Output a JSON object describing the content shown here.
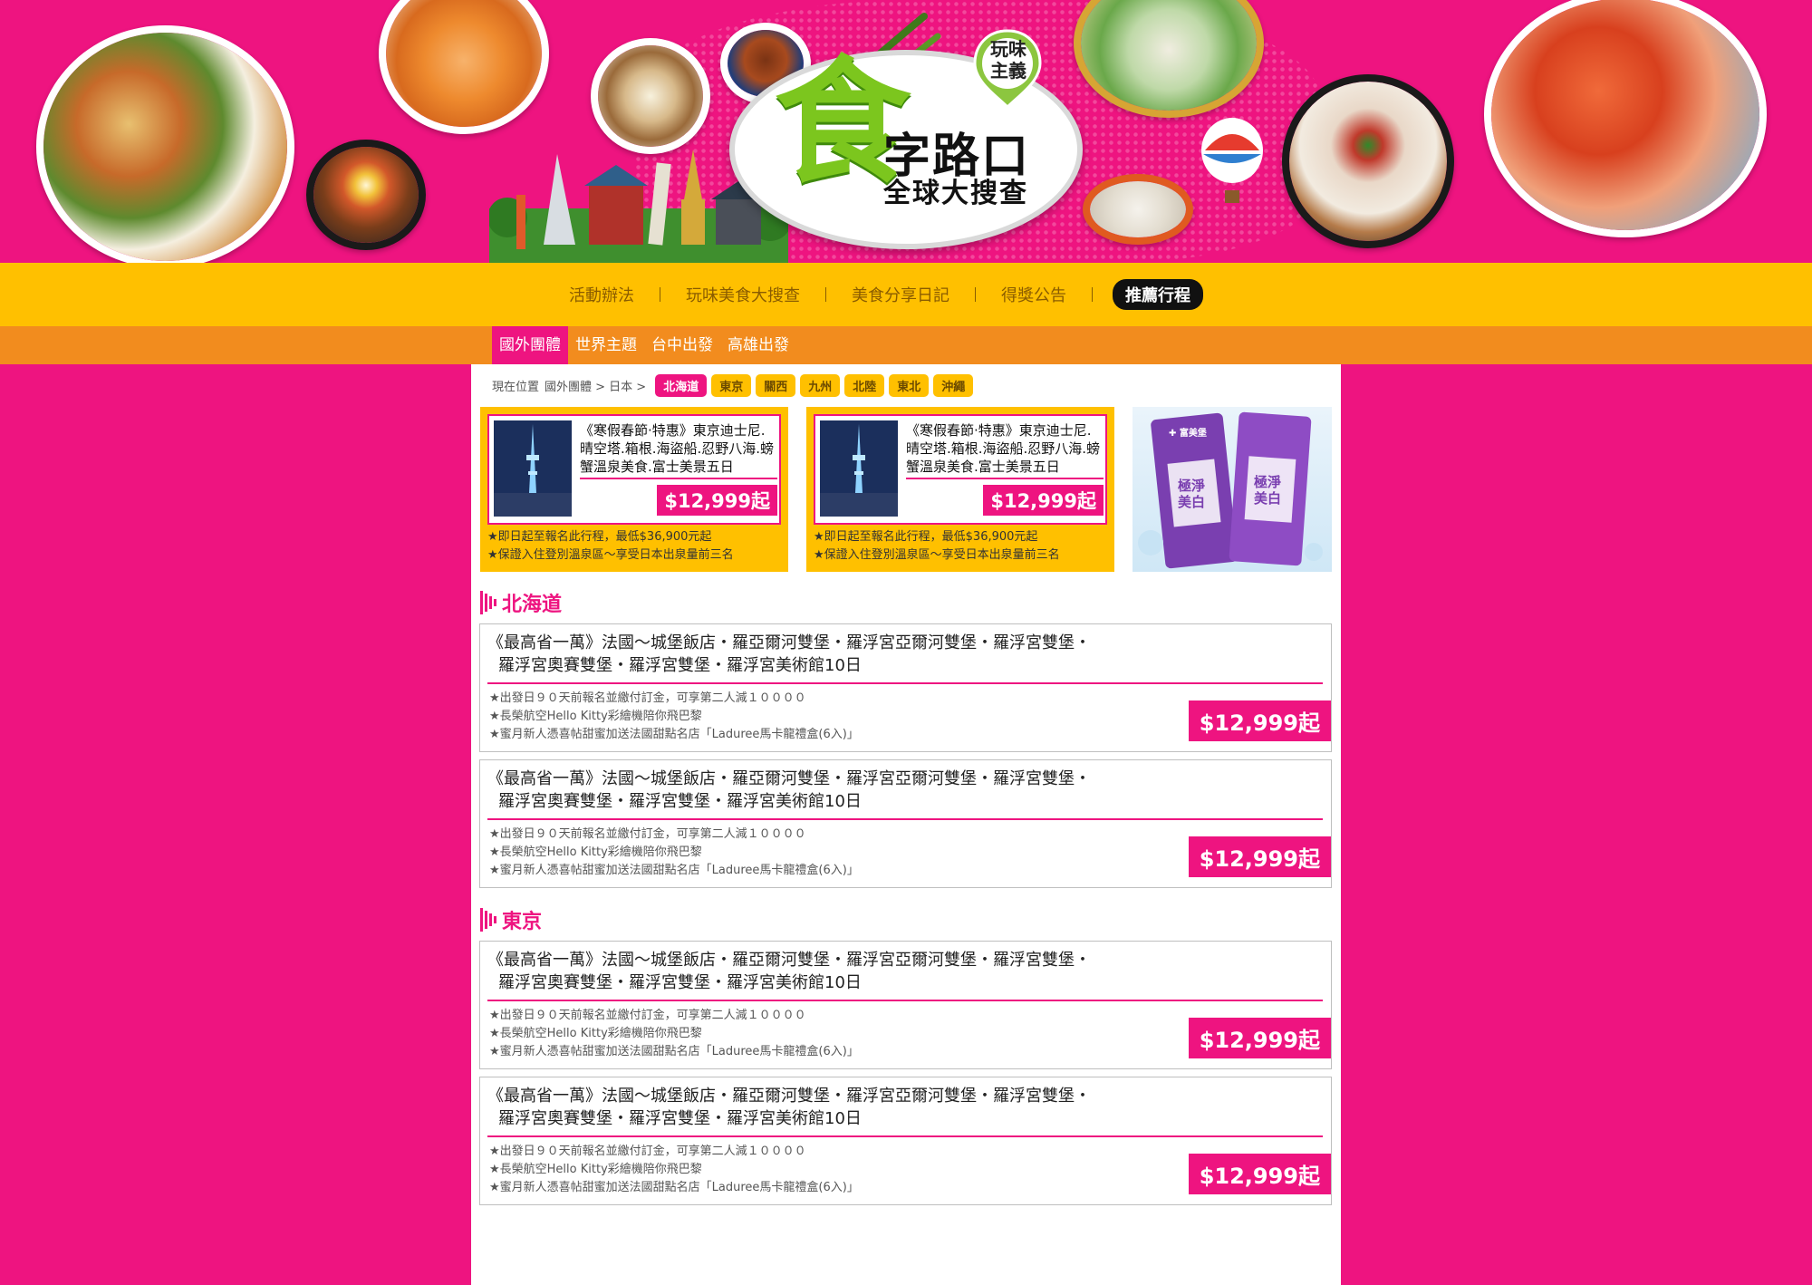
{
  "banner": {
    "logo_char": "食",
    "logo_line1": "字路口",
    "logo_line2": "全球大搜查",
    "badge_line1": "玩味",
    "badge_line2": "主義"
  },
  "main_nav": [
    {
      "label": "活動辦法",
      "active": false
    },
    {
      "label": "玩味美食大搜查",
      "active": false
    },
    {
      "label": "美食分享日記",
      "active": false
    },
    {
      "label": "得獎公告",
      "active": false
    },
    {
      "label": "推薦行程",
      "active": true
    }
  ],
  "sub_nav": [
    {
      "label": "國外團體",
      "active": true
    },
    {
      "label": "世界主題",
      "active": false
    },
    {
      "label": "台中出發",
      "active": false
    },
    {
      "label": "高雄出發",
      "active": false
    }
  ],
  "breadcrumb": {
    "prefix": "現在位置",
    "path": "國外團體 > 日本 >",
    "tags": [
      {
        "label": "北海道",
        "active": true
      },
      {
        "label": "東京",
        "active": false
      },
      {
        "label": "關西",
        "active": false
      },
      {
        "label": "九州",
        "active": false
      },
      {
        "label": "北陸",
        "active": false
      },
      {
        "label": "東北",
        "active": false
      },
      {
        "label": "沖繩",
        "active": false
      }
    ]
  },
  "promos": [
    {
      "title": "《寒假春節‧特惠》東京迪士尼.晴空塔.箱根.海盜船.忍野八海.螃蟹溫泉美食.富士美景五日",
      "price": "$12,999起",
      "note1": "★即日起至報名此行程，最低$36,900元起",
      "note2": "★保證入住登別溫泉區～享受日本出泉量前三名"
    },
    {
      "title": "《寒假春節‧特惠》東京迪士尼.晴空塔.箱根.海盜船.忍野八海.螃蟹溫泉美食.富士美景五日",
      "price": "$12,999起",
      "note1": "★即日起至報名此行程，最低$36,900元起",
      "note2": "★保證入住登別溫泉區～享受日本出泉量前三名"
    }
  ],
  "ad": {
    "brand": "✚ 富美堡",
    "product": "極淨美白"
  },
  "sections": [
    {
      "title": "北海道",
      "tours": [
        {
          "title1": "《最高省一萬》法國～城堡飯店・羅亞爾河雙堡・羅浮宮亞爾河雙堡・羅浮宮雙堡・",
          "title2": "羅浮宮奧賽雙堡・羅浮宮雙堡・羅浮宮美術館10日",
          "note1": "★出發日９０天前報名並繳付訂金，可享第二人減１００００",
          "note2": "★長榮航空Hello Kitty彩繪機陪你飛巴黎",
          "note3": "★蜜月新人憑喜帖甜蜜加送法國甜點名店「Laduree馬卡龍禮盒(6入)」",
          "price": "$12,999起"
        },
        {
          "title1": "《最高省一萬》法國～城堡飯店・羅亞爾河雙堡・羅浮宮亞爾河雙堡・羅浮宮雙堡・",
          "title2": "羅浮宮奧賽雙堡・羅浮宮雙堡・羅浮宮美術館10日",
          "note1": "★出發日９０天前報名並繳付訂金，可享第二人減１００００",
          "note2": "★長榮航空Hello Kitty彩繪機陪你飛巴黎",
          "note3": "★蜜月新人憑喜帖甜蜜加送法國甜點名店「Laduree馬卡龍禮盒(6入)」",
          "price": "$12,999起"
        }
      ]
    },
    {
      "title": "東京",
      "tours": [
        {
          "title1": "《最高省一萬》法國～城堡飯店・羅亞爾河雙堡・羅浮宮亞爾河雙堡・羅浮宮雙堡・",
          "title2": "羅浮宮奧賽雙堡・羅浮宮雙堡・羅浮宮美術館10日",
          "note1": "★出發日９０天前報名並繳付訂金，可享第二人減１００００",
          "note2": "★長榮航空Hello Kitty彩繪機陪你飛巴黎",
          "note3": "★蜜月新人憑喜帖甜蜜加送法國甜點名店「Laduree馬卡龍禮盒(6入)」",
          "price": "$12,999起"
        },
        {
          "title1": "《最高省一萬》法國～城堡飯店・羅亞爾河雙堡・羅浮宮亞爾河雙堡・羅浮宮雙堡・",
          "title2": "羅浮宮奧賽雙堡・羅浮宮雙堡・羅浮宮美術館10日",
          "note1": "★出發日９０天前報名並繳付訂金，可享第二人減１００００",
          "note2": "★長榮航空Hello Kitty彩繪機陪你飛巴黎",
          "note3": "★蜜月新人憑喜帖甜蜜加送法國甜點名店「Laduree馬卡龍禮盒(6入)」",
          "price": "$12,999起"
        }
      ]
    }
  ],
  "colors": {
    "brand_pink": "#ee1480",
    "nav_yellow": "#ffc000",
    "subnav_orange": "#f28c1e"
  }
}
